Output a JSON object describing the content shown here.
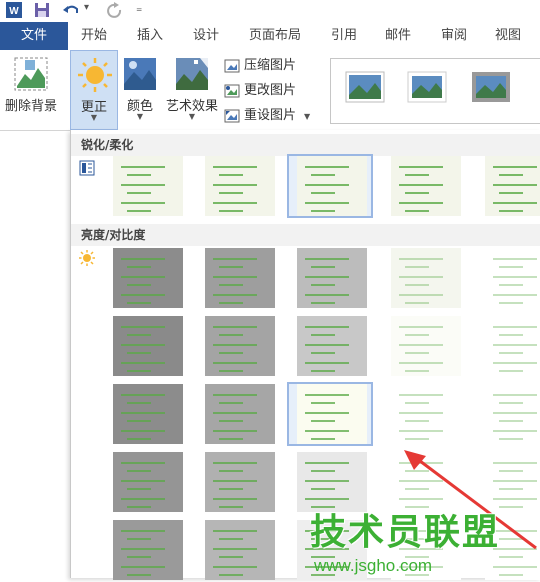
{
  "app": {
    "name": "Word"
  },
  "colors": {
    "accent": "#2b579a",
    "watermark": "#3cb034",
    "arrow": "#e53935",
    "selection": "#9ab7e3"
  },
  "qat": {
    "icons": [
      "word-logo-icon",
      "save-icon",
      "undo-icon",
      "redo-icon",
      "customize-icon"
    ],
    "undo_dropdown": "▾",
    "customize": "₌"
  },
  "tabs": [
    {
      "label": "文件"
    },
    {
      "label": "开始"
    },
    {
      "label": "插入"
    },
    {
      "label": "设计"
    },
    {
      "label": "页面布局"
    },
    {
      "label": "引用"
    },
    {
      "label": "邮件"
    },
    {
      "label": "审阅"
    },
    {
      "label": "视图"
    }
  ],
  "ribbon": {
    "remove_bg": "删除背景",
    "corrections": "更正",
    "color": "颜色",
    "artistic": "艺术效果",
    "compress": "压缩图片",
    "change": "更改图片",
    "reset": "重设图片",
    "dropdown_glyph": "▼"
  },
  "gallery": {
    "sharpen_header": "锐化/柔化",
    "brightness_header": "亮度/对比度",
    "sharpen_levels": 5,
    "brightness_rows": 5,
    "brightness_cols": 5,
    "selected_sharpen_index": 2,
    "selected_brightness": [
      2,
      2
    ]
  },
  "watermark": {
    "title": "技术员联盟",
    "url": "www.jsgho.com"
  }
}
